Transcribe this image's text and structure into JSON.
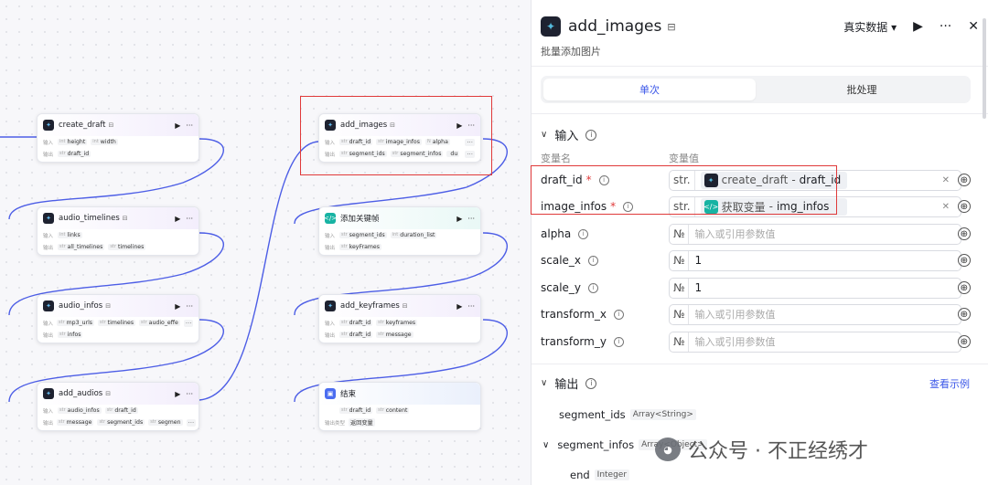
{
  "canvas": {
    "nodes": [
      {
        "title": "create_draft",
        "in_label": "输入",
        "out_label": "输出",
        "inputs": [
          {
            "t": "int",
            "n": "height"
          },
          {
            "t": "int",
            "n": "width"
          }
        ],
        "outputs": [
          {
            "t": "str",
            "n": "draft_id"
          }
        ]
      },
      {
        "title": "audio_timelines",
        "in_label": "输入",
        "out_label": "输出",
        "inputs": [
          {
            "t": "int",
            "n": "links"
          }
        ],
        "outputs": [
          {
            "t": "str",
            "n": "all_timelines"
          },
          {
            "t": "str",
            "n": "timelines"
          }
        ]
      },
      {
        "title": "audio_infos",
        "in_label": "输入",
        "out_label": "输出",
        "inputs": [
          {
            "t": "str",
            "n": "mp3_urls"
          },
          {
            "t": "str",
            "n": "timelines"
          },
          {
            "t": "str",
            "n": "audio_effe"
          }
        ],
        "outputs": [
          {
            "t": "str",
            "n": "infos"
          }
        ]
      },
      {
        "title": "add_audios",
        "in_label": "输入",
        "out_label": "输出",
        "inputs": [
          {
            "t": "str",
            "n": "audio_infos"
          },
          {
            "t": "str",
            "n": "draft_id"
          }
        ],
        "outputs": [
          {
            "t": "str",
            "n": "message"
          },
          {
            "t": "str",
            "n": "segment_ids"
          },
          {
            "t": "str",
            "n": "segmen"
          }
        ]
      },
      {
        "title": "add_images",
        "in_label": "输入",
        "out_label": "输出",
        "inputs": [
          {
            "t": "str",
            "n": "draft_id"
          },
          {
            "t": "str",
            "n": "image_infos"
          },
          {
            "t": "N",
            "n": "alpha"
          }
        ],
        "outputs": [
          {
            "t": "str",
            "n": "segment_ids"
          },
          {
            "t": "str",
            "n": "segment_infos"
          },
          {
            "t": "",
            "n": "du"
          }
        ]
      },
      {
        "title": "添加关键帧",
        "in_label": "输入",
        "out_label": "输出",
        "inputs": [
          {
            "t": "str",
            "n": "segment_ids"
          },
          {
            "t": "int",
            "n": "duration_list"
          }
        ],
        "outputs": [
          {
            "t": "str",
            "n": "keyFrames"
          }
        ]
      },
      {
        "title": "add_keyframes",
        "in_label": "输入",
        "out_label": "输出",
        "inputs": [
          {
            "t": "str",
            "n": "draft_id"
          },
          {
            "t": "str",
            "n": "keyframes"
          }
        ],
        "outputs": [
          {
            "t": "str",
            "n": "draft_id"
          },
          {
            "t": "str",
            "n": "message"
          }
        ]
      },
      {
        "title": "结束",
        "in_label": "",
        "out_label": "输出类型",
        "inputs": [
          {
            "t": "str",
            "n": "draft_id"
          },
          {
            "t": "str",
            "n": "content"
          }
        ],
        "outputs": [
          {
            "t": "",
            "n": "返回变量"
          }
        ]
      }
    ]
  },
  "panel": {
    "title": "add_images",
    "description": "批量添加图片",
    "mode": "真实数据",
    "tabs": [
      "单次",
      "批处理"
    ],
    "input_header": "输入",
    "col_name": "变量名",
    "col_value": "变量值",
    "params": [
      {
        "name": "draft_id",
        "type": "str.",
        "ref_source": "create_draft",
        "ref_sep": " - ",
        "ref_field": "draft_id",
        "value": "",
        "placeholder": ""
      },
      {
        "name": "image_infos",
        "type": "str.",
        "ref_source": "获取变量",
        "ref_sep": " - ",
        "ref_field": "img_infos",
        "value": "",
        "placeholder": ""
      },
      {
        "name": "alpha",
        "type": "№",
        "value": "",
        "placeholder": "输入或引用参数值"
      },
      {
        "name": "scale_x",
        "type": "№",
        "value": "1",
        "placeholder": ""
      },
      {
        "name": "scale_y",
        "type": "№",
        "value": "1",
        "placeholder": ""
      },
      {
        "name": "transform_x",
        "type": "№",
        "value": "",
        "placeholder": "输入或引用参数值"
      },
      {
        "name": "transform_y",
        "type": "№",
        "value": "",
        "placeholder": "输入或引用参数值"
      }
    ],
    "output_header": "输出",
    "view_example": "查看示例",
    "outputs": [
      {
        "name": "segment_ids",
        "type": "Array<String>"
      },
      {
        "name": "segment_infos",
        "type": "Array<Object>"
      },
      {
        "name": "end",
        "type": "Integer"
      }
    ],
    "watermark": "公众号 · 不正经绣才"
  },
  "colors": {
    "accent": "#3a56e8",
    "highlight": "#e03a3a",
    "teal": "#17b3a3"
  }
}
